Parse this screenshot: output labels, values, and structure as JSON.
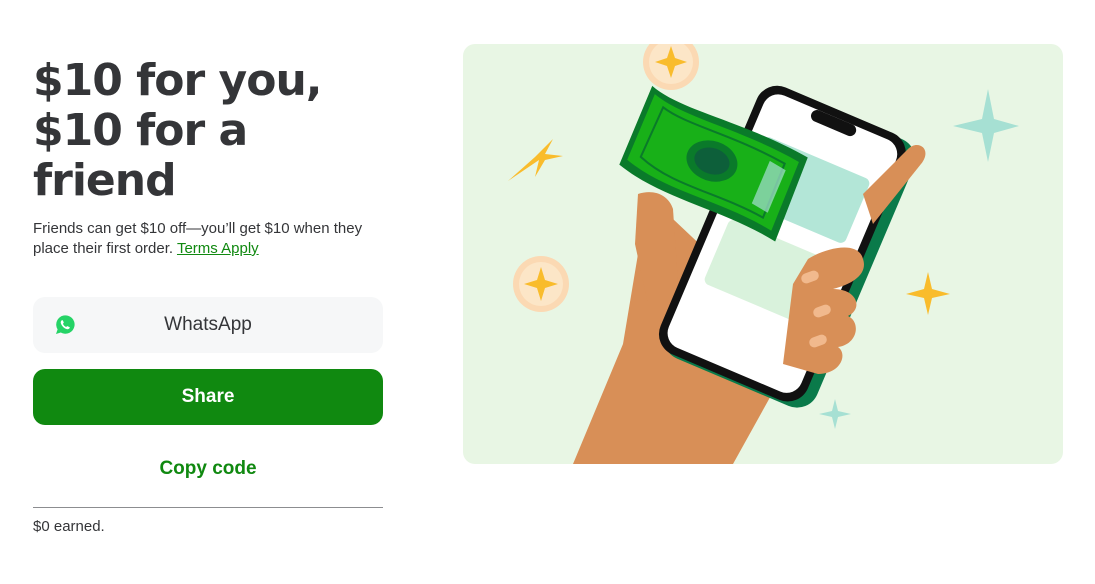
{
  "headline": {
    "line1": "$10 for you,",
    "line2": "$10 for a",
    "line3": "friend"
  },
  "description": {
    "text": "Friends can get $10 off—you’ll get $10 when they place their first order.",
    "terms_link": "Terms Apply"
  },
  "buttons": {
    "whatsapp": {
      "label": "WhatsApp",
      "icon": "whatsapp-icon"
    },
    "share": {
      "label": "Share"
    },
    "copy_code": {
      "label": "Copy code"
    }
  },
  "earnings": {
    "text": "$0 earned."
  },
  "colors": {
    "primary_green": "#108910",
    "text_dark": "#343538",
    "button_gray": "#f6f7f8",
    "illustration_bg": "#e8f6e4",
    "whatsapp_green": "#25d366"
  }
}
